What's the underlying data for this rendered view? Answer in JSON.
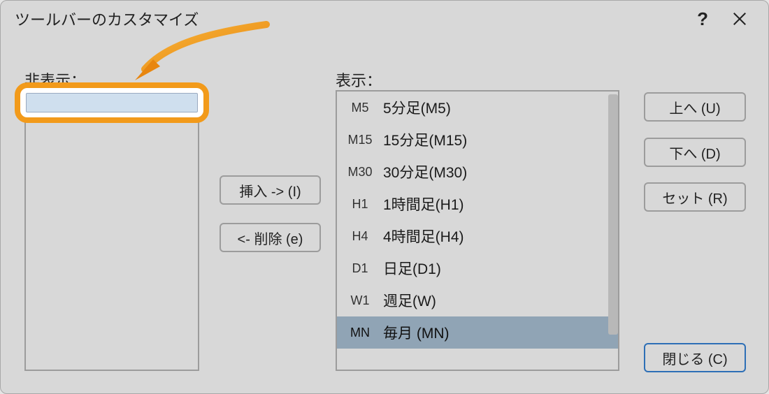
{
  "dialog": {
    "title": "ツールバーのカスタマイズ",
    "help_glyph": "?",
    "close_name": "close-icon"
  },
  "labels": {
    "hidden": "非表示：",
    "shown": "表示："
  },
  "hidden_items": [
    {
      "type": "separator"
    }
  ],
  "shown_items": [
    {
      "tag": "M5",
      "label": "5分足(M5)",
      "selected": false
    },
    {
      "tag": "M15",
      "label": "15分足(M15)",
      "selected": false
    },
    {
      "tag": "M30",
      "label": "30分足(M30)",
      "selected": false
    },
    {
      "tag": "H1",
      "label": "1時間足(H1)",
      "selected": false
    },
    {
      "tag": "H4",
      "label": "4時間足(H4)",
      "selected": false
    },
    {
      "tag": "D1",
      "label": "日足(D1)",
      "selected": false
    },
    {
      "tag": "W1",
      "label": "週足(W)",
      "selected": false
    },
    {
      "tag": "MN",
      "label": "毎月 (MN)",
      "selected": true
    }
  ],
  "buttons": {
    "insert": "挿入 -> (I)",
    "remove": "<- 削除 (e)",
    "up": "上へ (U)",
    "down": "下へ (D)",
    "set": "セット (R)",
    "close": "閉じる (C)"
  },
  "annotation": {
    "highlight_target": "hidden-list-first-item",
    "arrow_color": "#f29a1a"
  }
}
